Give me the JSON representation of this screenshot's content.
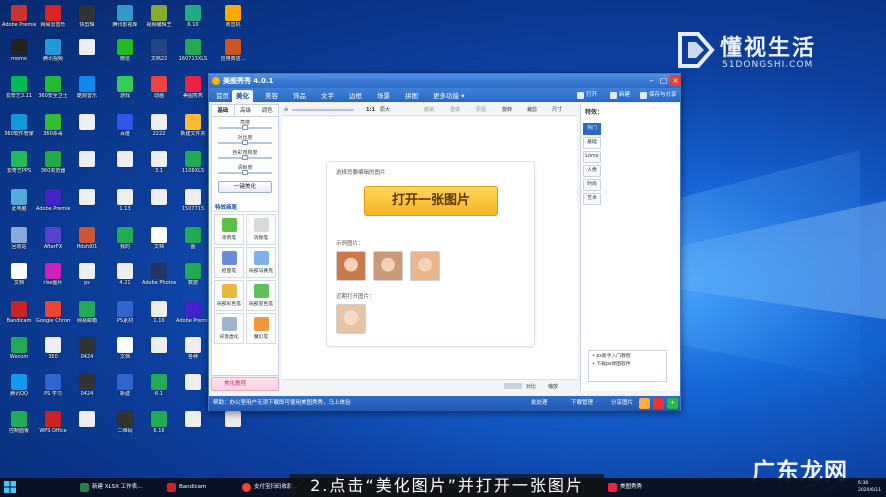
{
  "desktop": {
    "icons": [
      {
        "label": "Adobe Premie...",
        "color": "#c33"
      },
      {
        "label": "网易云音乐",
        "color": "#d22"
      },
      {
        "label": "快剪辑",
        "color": "#333"
      },
      {
        "label": "腾讯影视库",
        "color": "#39c"
      },
      {
        "label": "视频编辑王",
        "color": "#8a3"
      },
      {
        "label": "6.10",
        "color": "#2a8"
      },
      {
        "label": "收音机",
        "color": "#fa0"
      },
      {
        "label": "momo",
        "color": "#222"
      },
      {
        "label": "腾讯视频",
        "color": "#29d"
      },
      {
        "label": "",
        "color": "#eee"
      },
      {
        "label": "微信",
        "color": "#2b2"
      },
      {
        "label": "文档22",
        "color": "#248"
      },
      {
        "label": "160713XLS",
        "color": "#2a5"
      },
      {
        "label": "应用商店...",
        "color": "#c52"
      },
      {
        "label": "爱奇艺3.11",
        "color": "#0b5"
      },
      {
        "label": "360安全卫士",
        "color": "#2b3"
      },
      {
        "label": "酷狗音乐",
        "color": "#18e"
      },
      {
        "label": "游戏",
        "color": "#3c5"
      },
      {
        "label": "动画",
        "color": "#e44"
      },
      {
        "label": "美图秀秀",
        "color": "#e24"
      },
      {
        "label": "",
        "color": "#eee"
      },
      {
        "label": "360软件管家",
        "color": "#19d"
      },
      {
        "label": "360杀毒",
        "color": "#3b3"
      },
      {
        "label": "",
        "color": "#eee"
      },
      {
        "label": "百度",
        "color": "#35e"
      },
      {
        "label": "2222",
        "color": "#eee"
      },
      {
        "label": "新建文件夹",
        "color": "#fb3"
      },
      {
        "label": "",
        "color": "#eee"
      },
      {
        "label": "爱奇艺PPS",
        "color": "#2b5"
      },
      {
        "label": "360浏览器",
        "color": "#2a4"
      },
      {
        "label": "",
        "color": "#eee"
      },
      {
        "label": "",
        "color": "#eee"
      },
      {
        "label": "3.1",
        "color": "#eee"
      },
      {
        "label": "1106XLS",
        "color": "#2a5"
      },
      {
        "label": "",
        "color": "#eee"
      },
      {
        "label": "此电脑",
        "color": "#5ad"
      },
      {
        "label": "Adobe Premie...",
        "color": "#42c"
      },
      {
        "label": "",
        "color": "#eee"
      },
      {
        "label": "1.13",
        "color": "#eee"
      },
      {
        "label": "",
        "color": "#eee"
      },
      {
        "label": "1507715",
        "color": "#eee"
      },
      {
        "label": "",
        "color": "#eee"
      },
      {
        "label": "回收站",
        "color": "#8ad"
      },
      {
        "label": "AfterFX",
        "color": "#54c"
      },
      {
        "label": "ffdsfd01",
        "color": "#c53"
      },
      {
        "label": "我的",
        "color": "#2a5"
      },
      {
        "label": "文档",
        "color": "#fff"
      },
      {
        "label": "图",
        "color": "#2a5"
      },
      {
        "label": "",
        "color": "#eee"
      },
      {
        "label": "文档",
        "color": "#fff"
      },
      {
        "label": "rise图片",
        "color": "#c2b"
      },
      {
        "label": "ps",
        "color": "#eee"
      },
      {
        "label": "4.21",
        "color": "#eee"
      },
      {
        "label": "Adobe Photosh...",
        "color": "#236"
      },
      {
        "label": "数据",
        "color": "#2a5"
      },
      {
        "label": "",
        "color": "#eee"
      },
      {
        "label": "Bandicam",
        "color": "#c22"
      },
      {
        "label": "Google Chrome",
        "color": "#e43"
      },
      {
        "label": "网易邮箱",
        "color": "#2a5"
      },
      {
        "label": "PS素材",
        "color": "#36c"
      },
      {
        "label": "1.10",
        "color": "#eee"
      },
      {
        "label": "Adobe Premiere...",
        "color": "#42c"
      },
      {
        "label": "",
        "color": "#eee"
      },
      {
        "label": "Wecom",
        "color": "#2a5"
      },
      {
        "label": "360",
        "color": "#eee"
      },
      {
        "label": "0424",
        "color": "#333"
      },
      {
        "label": "文档",
        "color": "#fff"
      },
      {
        "label": "",
        "color": "#eee"
      },
      {
        "label": "各种",
        "color": "#eee"
      },
      {
        "label": "",
        "color": "#eee"
      },
      {
        "label": "腾讯QQ",
        "color": "#19e"
      },
      {
        "label": "PS 学习",
        "color": "#36c"
      },
      {
        "label": "0424",
        "color": "#333"
      },
      {
        "label": "新建",
        "color": "#36c"
      },
      {
        "label": "6.1",
        "color": "#2a5"
      },
      {
        "label": "",
        "color": "#eee"
      },
      {
        "label": "",
        "color": "#eee"
      },
      {
        "label": "控制面板",
        "color": "#2a5"
      },
      {
        "label": "WPS Office",
        "color": "#c22"
      },
      {
        "label": "",
        "color": "#eee"
      },
      {
        "label": "二维码",
        "color": "#333"
      },
      {
        "label": "6.16",
        "color": "#2a5"
      },
      {
        "label": "",
        "color": "#eee"
      },
      {
        "label": "",
        "color": "#eee"
      }
    ]
  },
  "watermark": {
    "cn": "懂视生活",
    "en": "51DONGSHI.COM",
    "bottom": "广东龙网"
  },
  "window": {
    "title": "美图秀秀 4.0.1",
    "tabs": [
      "首页",
      "美化",
      "美容",
      "饰品",
      "文字",
      "边框",
      "场景",
      "拼图",
      "更多功能 ▾"
    ],
    "active_tab": "美化",
    "right_actions": [
      "打开",
      "新建",
      "保存与分享"
    ],
    "controls": [
      "–",
      "□",
      "×"
    ],
    "left_panel": {
      "subtabs": [
        "基础",
        "高级",
        "调色"
      ],
      "sliders": [
        {
          "label": "亮度",
          "value": 0.5
        },
        {
          "label": "对比度",
          "value": 0.5
        },
        {
          "label": "色彩饱和度",
          "value": 0.5
        },
        {
          "label": "清晰度",
          "value": 0.5
        }
      ],
      "one_key": "一键美化",
      "section": "特效画笔",
      "tools": [
        {
          "label": "涂鸦笔",
          "color": "#5bc046"
        },
        {
          "label": "消除笔",
          "color": "#d9d9d9"
        },
        {
          "label": "抠图笔",
          "color": "#6a8bd6"
        },
        {
          "label": "局部马赛克",
          "color": "#7fb0e8"
        },
        {
          "label": "局部彩色笔",
          "color": "#e9b640"
        },
        {
          "label": "局部变色笔",
          "color": "#5cbf5c"
        },
        {
          "label": "背景虚化",
          "color": "#9fb4c8"
        },
        {
          "label": "魔幻笔",
          "color": "#ef9a3a"
        }
      ],
      "bottom_label": "美化教程"
    },
    "top_toolbar": {
      "zoom": "1:1",
      "orig": "原大",
      "actions": [
        "撤销",
        "重做",
        "原图",
        "旋转",
        "裁剪",
        "尺寸"
      ]
    },
    "canvas": {
      "hint": "选择您要编辑的图片",
      "open_button": "打开一张图片",
      "samples_label": "示例图片：",
      "recent_label": "近期打开图片：",
      "samples": [
        {
          "color": "#c97a4c"
        },
        {
          "color": "#c99a7a"
        },
        {
          "color": "#e8b58f"
        }
      ],
      "recent": [
        {
          "color": "#e6c3a5"
        }
      ]
    },
    "right_panel": {
      "header": "特效：",
      "tabs": [
        "热门",
        "基础",
        "Lomo",
        "人像",
        "时尚",
        "艺术"
      ],
      "active": "热门",
      "news": [
        "• ps新手入门教程",
        "• 下载ps修图软件"
      ]
    },
    "bottom_bar": {
      "compare": "对比",
      "zoom_label": "缩放"
    },
    "status": {
      "left": "帮助：办公室用户无须下载即可使用美图秀秀，马上体验",
      "items": [
        "批处理",
        "下载管理",
        "分享图片"
      ]
    }
  },
  "taskbar": {
    "items": [
      "新建 XLSX 工作表...",
      "Bandicam",
      "支付宝扫码收款...",
      "美图秀秀"
    ],
    "time": "6:38",
    "date": "2020/6/11"
  },
  "subtitle": "2.点击“美化图片”并打开一张图片"
}
